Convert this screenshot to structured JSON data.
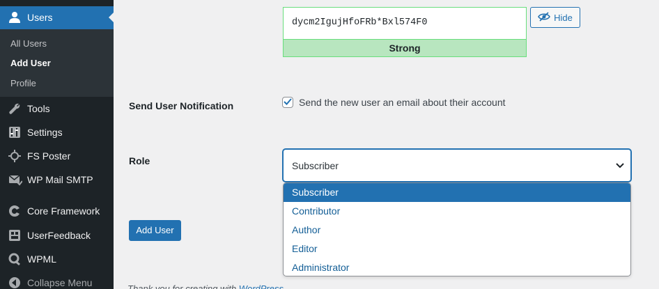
{
  "sidebar": {
    "active_menu": {
      "label": "Users",
      "icon": "users-icon"
    },
    "submenu": [
      {
        "label": "All Users",
        "current": false
      },
      {
        "label": "Add User",
        "current": true
      },
      {
        "label": "Profile",
        "current": false
      }
    ],
    "items": [
      {
        "label": "Tools",
        "icon": "wrench-icon"
      },
      {
        "label": "Settings",
        "icon": "settings-icon"
      },
      {
        "label": "FS Poster",
        "icon": "fs-poster-icon"
      },
      {
        "label": "WP Mail SMTP",
        "icon": "mail-icon"
      },
      {
        "label": "Core Framework",
        "icon": "core-framework-icon"
      },
      {
        "label": "UserFeedback",
        "icon": "userfeedback-icon"
      },
      {
        "label": "WPML",
        "icon": "wpml-icon"
      }
    ],
    "collapse": {
      "label": "Collapse Menu",
      "icon": "collapse-icon"
    }
  },
  "password": {
    "value": "dycm2IgujHfoFRb*Bxl574F0",
    "strength": "Strong",
    "hide_label": "Hide"
  },
  "notification": {
    "label": "Send User Notification",
    "checkbox_text": "Send the new user an email about their account",
    "checked": true
  },
  "role": {
    "label": "Role",
    "selected": "Subscriber",
    "options": [
      "Subscriber",
      "Contributor",
      "Author",
      "Editor",
      "Administrator"
    ]
  },
  "add_user_button": "Add User",
  "footer": {
    "text": "Thank you for creating with ",
    "link": "WordPress."
  },
  "colors": {
    "accent": "#2271b1",
    "sidebar_bg": "#1d2327",
    "strong_bg": "#b8e6bf",
    "strong_border": "#68de7c"
  }
}
